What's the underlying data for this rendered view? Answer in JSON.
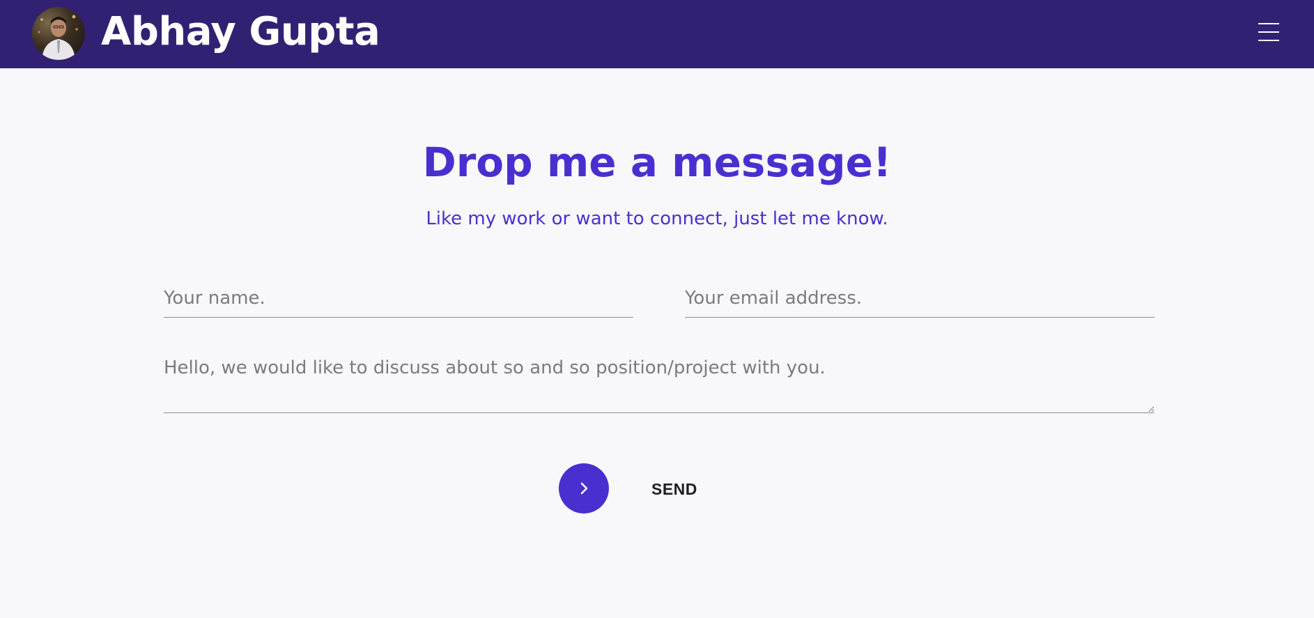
{
  "header": {
    "name": "Abhay Gupta",
    "background_color": "#322173",
    "avatar_icon": "profile-photo",
    "menu_icon": "hamburger-menu-icon"
  },
  "contact": {
    "title": "Drop me a message!",
    "subtitle": "Like my work or want to connect, just let me know.",
    "accent_color": "#4a2fd0",
    "name_placeholder": "Your name.",
    "email_placeholder": "Your email address.",
    "message_placeholder": "Hello, we would like to discuss about so and so position/project with you.",
    "send_label": "SEND",
    "send_icon": "chevron-right-icon"
  }
}
